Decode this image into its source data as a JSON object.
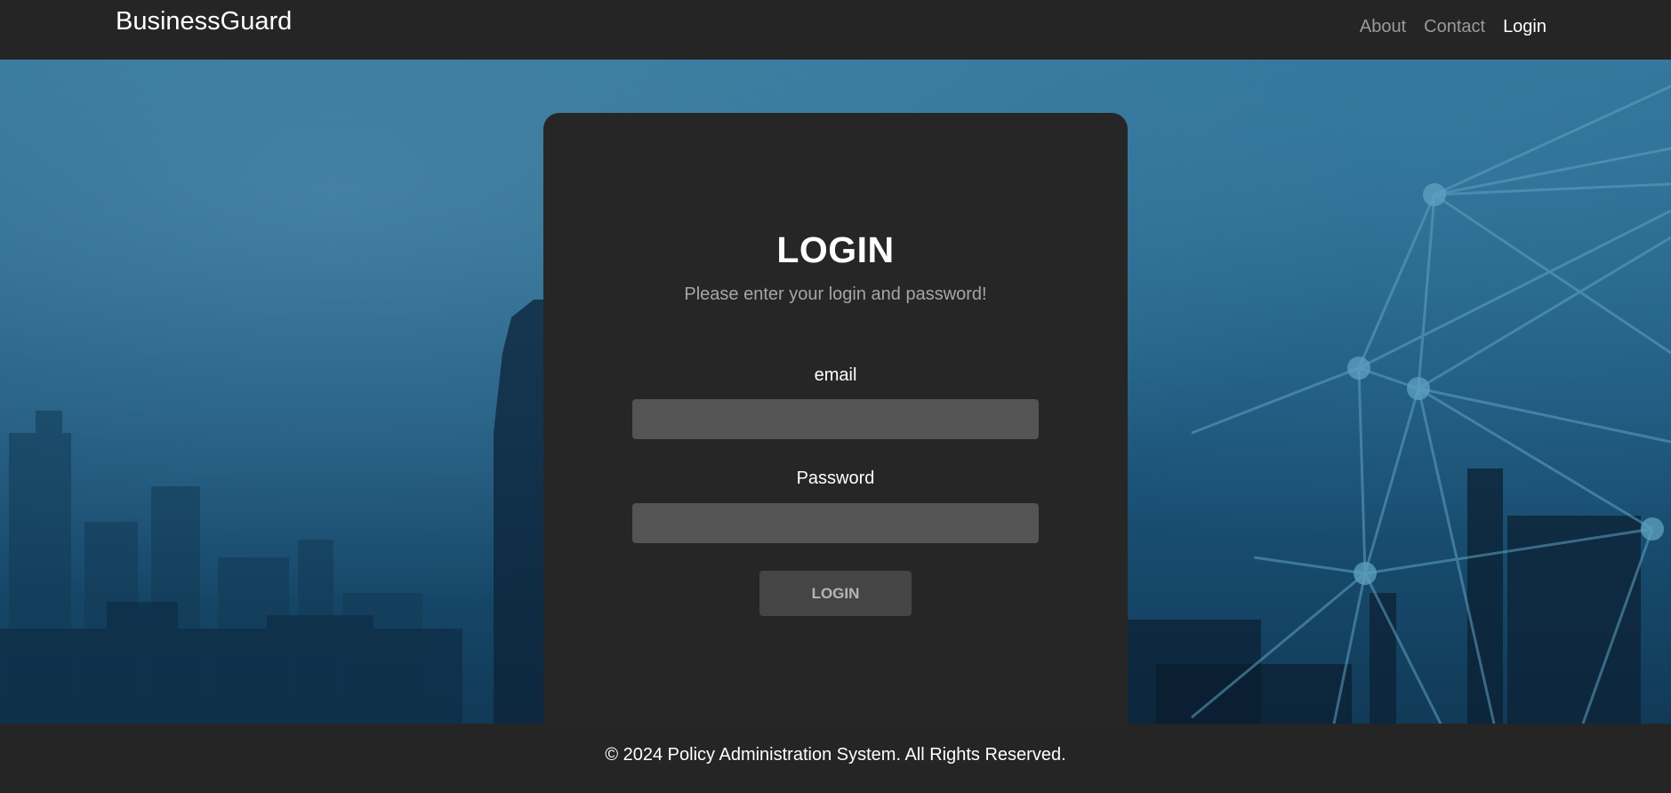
{
  "navbar": {
    "brand": "BusinessGuard",
    "links": [
      {
        "label": "About"
      },
      {
        "label": "Contact"
      },
      {
        "label": "Login"
      }
    ]
  },
  "login_card": {
    "title": "LOGIN",
    "subtitle": "Please enter your login and password!",
    "email_label": "email",
    "email_value": "",
    "password_label": "Password",
    "password_value": "",
    "submit_label": "LOGIN"
  },
  "footer": {
    "text": "© 2024 Policy Administration System. All Rights Reserved."
  },
  "colors": {
    "navbar_bg": "#252525",
    "card_bg": "#262626",
    "input_bg": "#545454",
    "button_bg": "#454545",
    "hero_blue": "#1f5a80"
  }
}
